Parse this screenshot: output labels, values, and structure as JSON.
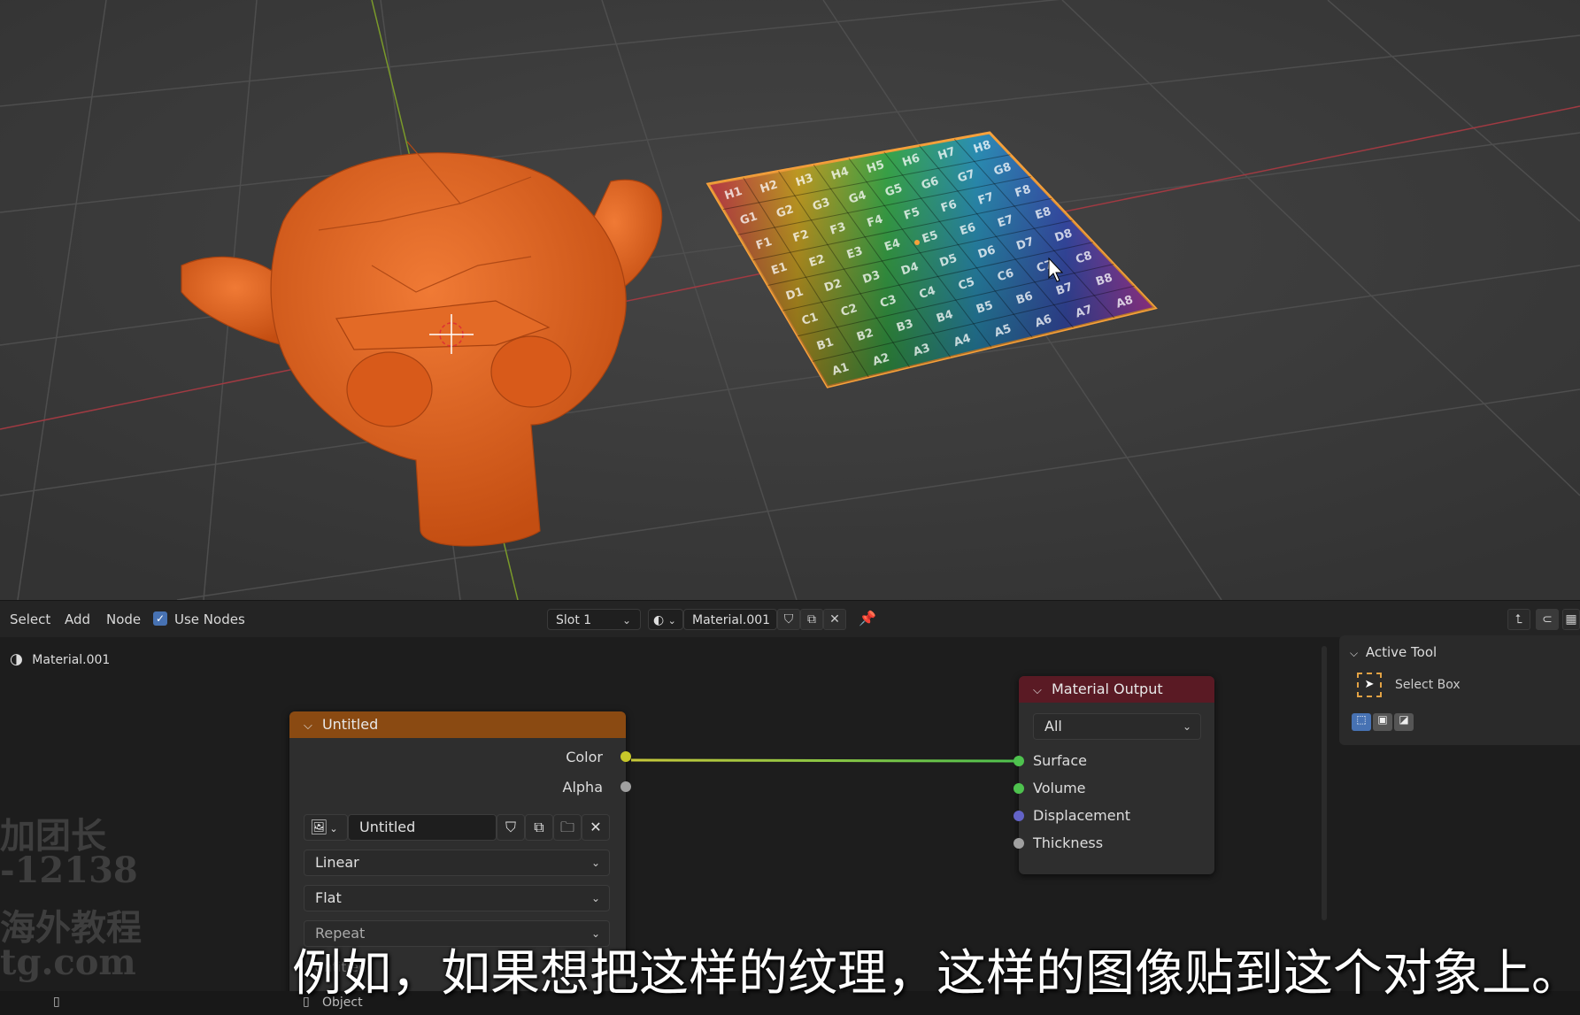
{
  "viewport": {
    "uv_cells": [
      [
        "H1",
        "H2",
        "H3",
        "H4",
        "H5",
        "H6",
        "H7",
        "H8"
      ],
      [
        "G1",
        "G2",
        "G3",
        "G4",
        "G5",
        "G6",
        "G7",
        "G8"
      ],
      [
        "F1",
        "F2",
        "F3",
        "F4",
        "F5",
        "F6",
        "F7",
        "F8"
      ],
      [
        "E1",
        "E2",
        "E3",
        "E4",
        "E5",
        "E6",
        "E7",
        "E8"
      ],
      [
        "D1",
        "D2",
        "D3",
        "D4",
        "D5",
        "D6",
        "D7",
        "D8"
      ],
      [
        "C1",
        "C2",
        "C3",
        "C4",
        "C5",
        "C6",
        "C7",
        "C8"
      ],
      [
        "B1",
        "B2",
        "B3",
        "B4",
        "B5",
        "B6",
        "B7",
        "B8"
      ],
      [
        "A1",
        "A2",
        "A3",
        "A4",
        "A5",
        "A6",
        "A7",
        "A8"
      ]
    ],
    "monkey_color": "#e0611f",
    "selection_outline": "#f7a13b"
  },
  "header": {
    "menu": [
      "Select",
      "Add",
      "Node"
    ],
    "use_nodes_label": "Use Nodes",
    "use_nodes_checked": true,
    "slot": "Slot 1",
    "material": "Material.001"
  },
  "breadcrumb": {
    "material": "Material.001"
  },
  "image_node": {
    "title": "Untitled",
    "outputs": [
      "Color",
      "Alpha"
    ],
    "image_name": "Untitled",
    "interpolation": "Linear",
    "projection": "Flat",
    "extension": "Repeat",
    "extra_partial": "Untitled"
  },
  "output_node": {
    "title": "Material Output",
    "target": "All",
    "inputs": [
      "Surface",
      "Volume",
      "Displacement",
      "Thickness"
    ]
  },
  "side_panel": {
    "section": "Active Tool",
    "tool": "Select Box"
  },
  "status_bar": {
    "mode": "Object"
  },
  "watermark": {
    "lines": [
      "加团长",
      "-12138",
      "海外教程",
      "tg.com"
    ]
  },
  "subtitle": "例如，如果想把这样的纹理，这样的图像贴到这个对象上。",
  "colors": {
    "header_bg": "#242424",
    "node_editor_bg": "#1d1d1d",
    "image_node_header": "#8a4a12",
    "output_node_header": "#5a1a24",
    "accent_blue": "#4772b3"
  }
}
